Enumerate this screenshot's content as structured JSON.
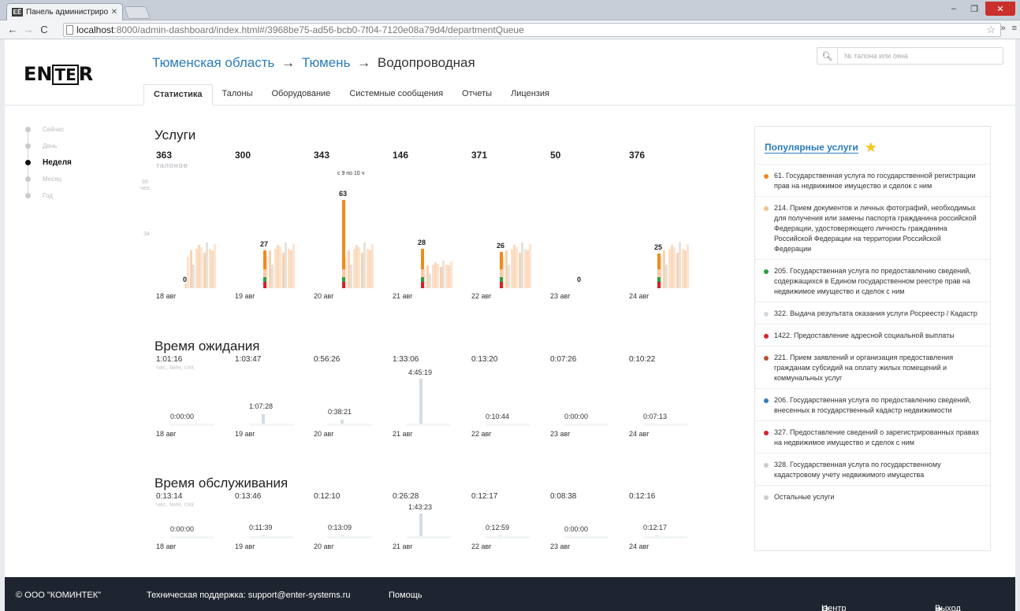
{
  "browser": {
    "tab_title": "Панель администрирова",
    "favicon_text": "ЕЁ",
    "url_host": "localhost",
    "url_rest": ":8000/admin-dashboard/index.html#/3968be75-ad56-bcb0-7f04-7120e08a79d4/departmentQueue"
  },
  "header": {
    "logo_left": "EN",
    "logo_box": "TE",
    "logo_right": "R",
    "crumb_region": "Тюменская область",
    "crumb_city": "Тюмень",
    "crumb_office": "Водопроводная",
    "arrow": "→",
    "search_placeholder": "№ талона или окна"
  },
  "tabs": [
    "Статистика",
    "Талоны",
    "Оборудование",
    "Системные сообщения",
    "Отчеты",
    "Лицензия"
  ],
  "timeline": [
    "Сейчас",
    "День",
    "Неделя",
    "Месяц",
    "Год"
  ],
  "services": {
    "title": "Услуги",
    "unit": "талонов",
    "axis_top": "69",
    "axis_top_unit": "чел.",
    "axis_mid": "34",
    "peak_hint": "с 9 по 10 ч",
    "days": [
      {
        "date": "18 авг",
        "total": "363",
        "peak": "0"
      },
      {
        "date": "19 авг",
        "total": "300",
        "peak": "27"
      },
      {
        "date": "20 авг",
        "total": "343",
        "peak": "63"
      },
      {
        "date": "21 авг",
        "total": "146",
        "peak": "28"
      },
      {
        "date": "22 авг",
        "total": "371",
        "peak": "26"
      },
      {
        "date": "23 авг",
        "total": "50",
        "peak": "0"
      },
      {
        "date": "24 авг",
        "total": "376",
        "peak": "25"
      }
    ]
  },
  "wait": {
    "title": "Время ожидания",
    "unit": "час, мин, сек",
    "days": [
      {
        "date": "18 авг",
        "avg": "1:01:16",
        "max": "0:00:00",
        "level": 0
      },
      {
        "date": "19 авг",
        "avg": "1:03:47",
        "max": "1:07:28",
        "level": 0.25
      },
      {
        "date": "20 авг",
        "avg": "0:56:26",
        "max": "0:38:21",
        "level": 0.14
      },
      {
        "date": "21 авг",
        "avg": "1:33:06",
        "max": "4:45:19",
        "level": 1
      },
      {
        "date": "22 авг",
        "avg": "0:13:20",
        "max": "0:10:44",
        "level": 0.04
      },
      {
        "date": "23 авг",
        "avg": "0:07:26",
        "max": "0:00:00",
        "level": 0
      },
      {
        "date": "24 авг",
        "avg": "0:10:22",
        "max": "0:07:13",
        "level": 0.03
      }
    ]
  },
  "service_time": {
    "title": "Время обслуживания",
    "unit": "час, мин, сек",
    "days": [
      {
        "date": "18 авг",
        "avg": "0:13:14",
        "max": "0:00:00",
        "level": 0
      },
      {
        "date": "19 авг",
        "avg": "0:13:46",
        "max": "0:11:39",
        "level": 0.11
      },
      {
        "date": "20 авг",
        "avg": "0:12:10",
        "max": "0:13:09",
        "level": 0.13
      },
      {
        "date": "21 авг",
        "avg": "0:26:28",
        "max": "1:43:23",
        "level": 1
      },
      {
        "date": "22 авг",
        "avg": "0:12:17",
        "max": "0:12:59",
        "level": 0.12
      },
      {
        "date": "23 авг",
        "avg": "0:08:38",
        "max": "0:00:00",
        "level": 0
      },
      {
        "date": "24 авг",
        "avg": "0:12:16",
        "max": "0:12:17",
        "level": 0.12
      }
    ]
  },
  "popular": {
    "title": "Популярные услуги",
    "items": [
      {
        "text": "61. Государственная услуга по государственной регистрации прав на недвижимое имущество и сделок с ним",
        "color": "#f08a1c"
      },
      {
        "text": "214. Прием документов и личных фотографий, необходимых для получения или замены паспорта гражданина российской Федерации, удостоверяющего личность гражданина Российской Федерации на территории Российской Федерации",
        "color": "#f6c28a"
      },
      {
        "text": "205. Государственная услуга по предоставлению сведений, содержащихся в Едином государственном реестре прав на недвижимое имущество и сделок с ним",
        "color": "#2e9e3e"
      },
      {
        "text": "322. Выдача результата оказания услуги Росреестр / Кадастр",
        "color": "#d3dbe1"
      },
      {
        "text": "1422. Предоставление адресной социальной выплаты",
        "color": "#d8202a"
      },
      {
        "text": "221. Прием заявлений и организация предоставления гражданам субсидий на оплату жилых помещений и коммунальных услуг",
        "color": "#b5532b"
      },
      {
        "text": "206. Государственная услуга по предоставлению сведений, внесенных в государственный кадастр недвижимости",
        "color": "#2b7fc0"
      },
      {
        "text": "327. Предоставление сведений о зарегистрированных правах на недвижимое имущество и сделок с ним",
        "color": "#d8202a"
      },
      {
        "text": "328. Государственная услуга по государственному кадастровому учету недвижимого имущества",
        "color": "#c9ccd0"
      },
      {
        "text": "Остальные услуги",
        "color": "#c9ccd0"
      }
    ]
  },
  "footer": {
    "company": "© ООО \"КОМИНТЕК\"",
    "support": "Техническая поддержка: support@enter-systems.ru",
    "help": "Помощь",
    "settings": "Центр настройки",
    "logout": "Выход"
  }
}
